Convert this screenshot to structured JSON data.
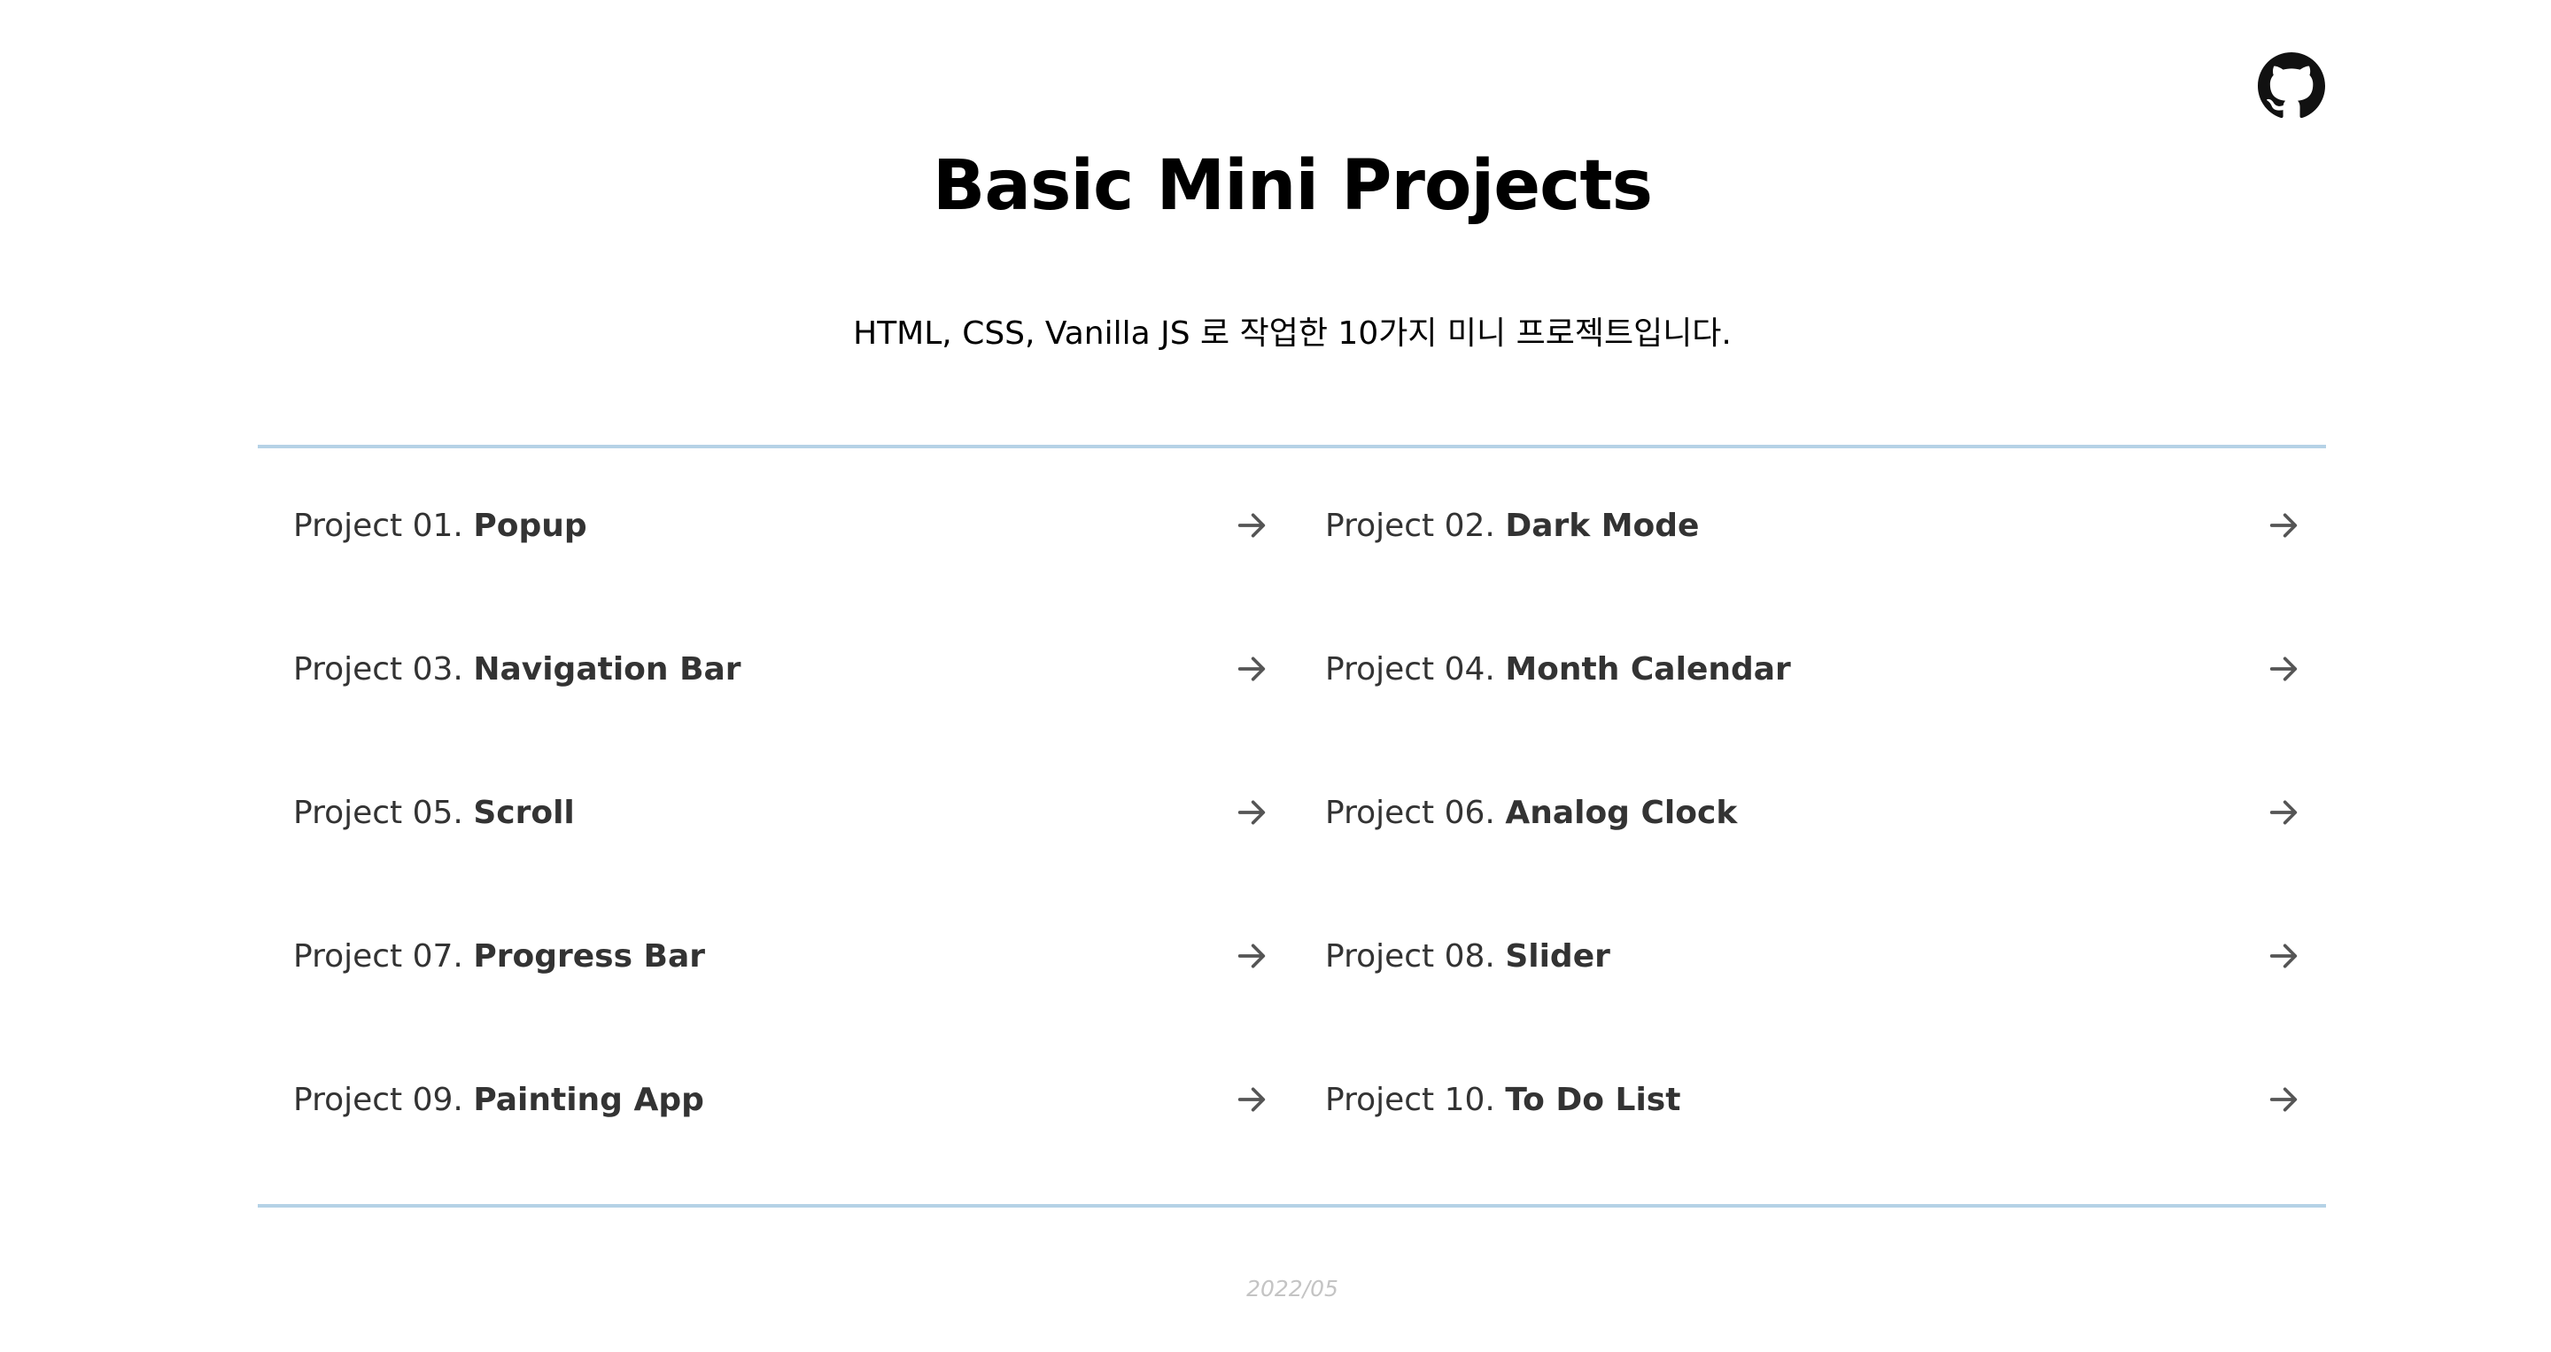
{
  "header": {
    "github_icon": "github-icon",
    "title": "Basic Mini Projects",
    "subtitle": "HTML, CSS, Vanilla JS 로 작업한 10가지 미니 프로젝트입니다."
  },
  "projects": [
    {
      "number": "Project 01.",
      "name": "Popup"
    },
    {
      "number": "Project 02.",
      "name": "Dark Mode"
    },
    {
      "number": "Project 03.",
      "name": "Navigation Bar"
    },
    {
      "number": "Project 04.",
      "name": "Month Calendar"
    },
    {
      "number": "Project 05.",
      "name": "Scroll"
    },
    {
      "number": "Project 06.",
      "name": "Analog Clock"
    },
    {
      "number": "Project 07.",
      "name": "Progress Bar"
    },
    {
      "number": "Project 08.",
      "name": "Slider"
    },
    {
      "number": "Project 09.",
      "name": "Painting App"
    },
    {
      "number": "Project 10.",
      "name": "To Do List"
    }
  ],
  "footer": {
    "date": "2022/05"
  },
  "colors": {
    "divider": "#b5d2e6",
    "text": "#333333",
    "footer_text": "#c4c4c4"
  }
}
